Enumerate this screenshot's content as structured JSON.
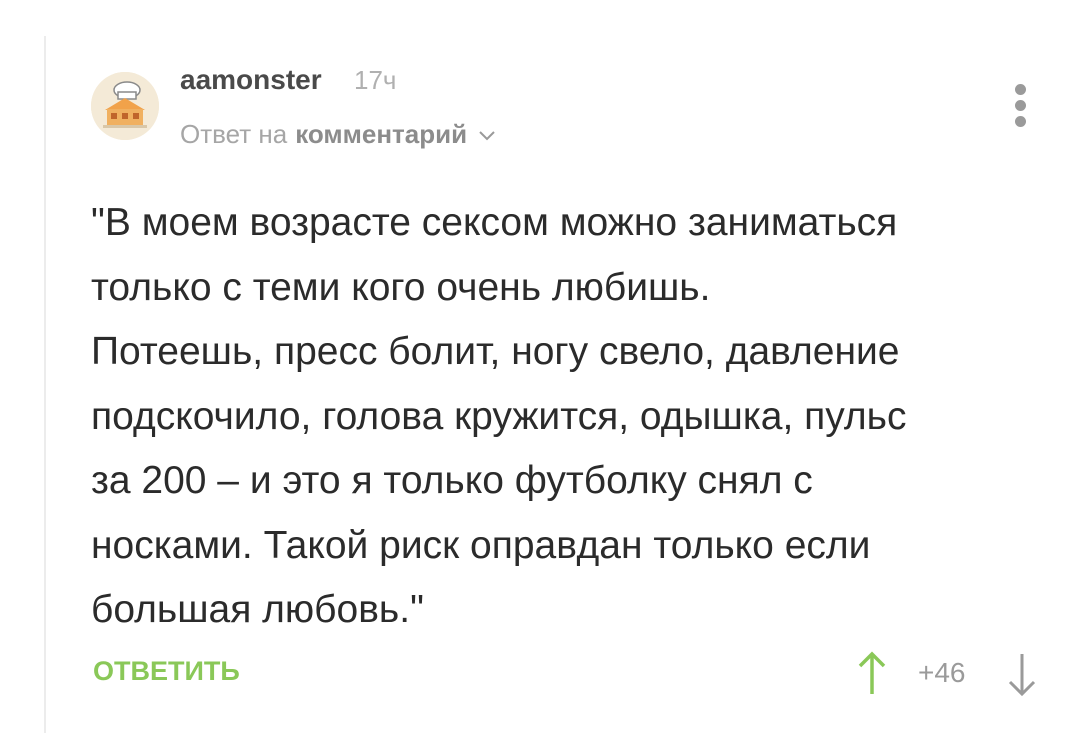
{
  "comment": {
    "author": "aamonster",
    "time_ago": "17ч",
    "reply_prefix": "Ответ на",
    "reply_target": "комментарий",
    "text": "\"В моем возрасте сексом можно заниматься\nтолько с теми кого очень любишь.\nПотеешь, пресс болит, ногу свело, давление\nподскочило, голова кружится, одышка, пульс\nза 200 – и это я только футболку снял с\nносками. Такой риск оправдан только если\nбольшая любовь.\"",
    "reply_button_label": "ОТВЕТИТЬ",
    "rating": "+46"
  },
  "icons": {
    "menu": "more-vertical-icon",
    "chevron": "chevron-down-icon",
    "upvote": "arrow-up-icon",
    "downvote": "arrow-down-icon"
  },
  "colors": {
    "accent_green": "#8ac858",
    "text_primary": "#2b2b2b",
    "text_muted": "#a6a6a6"
  }
}
